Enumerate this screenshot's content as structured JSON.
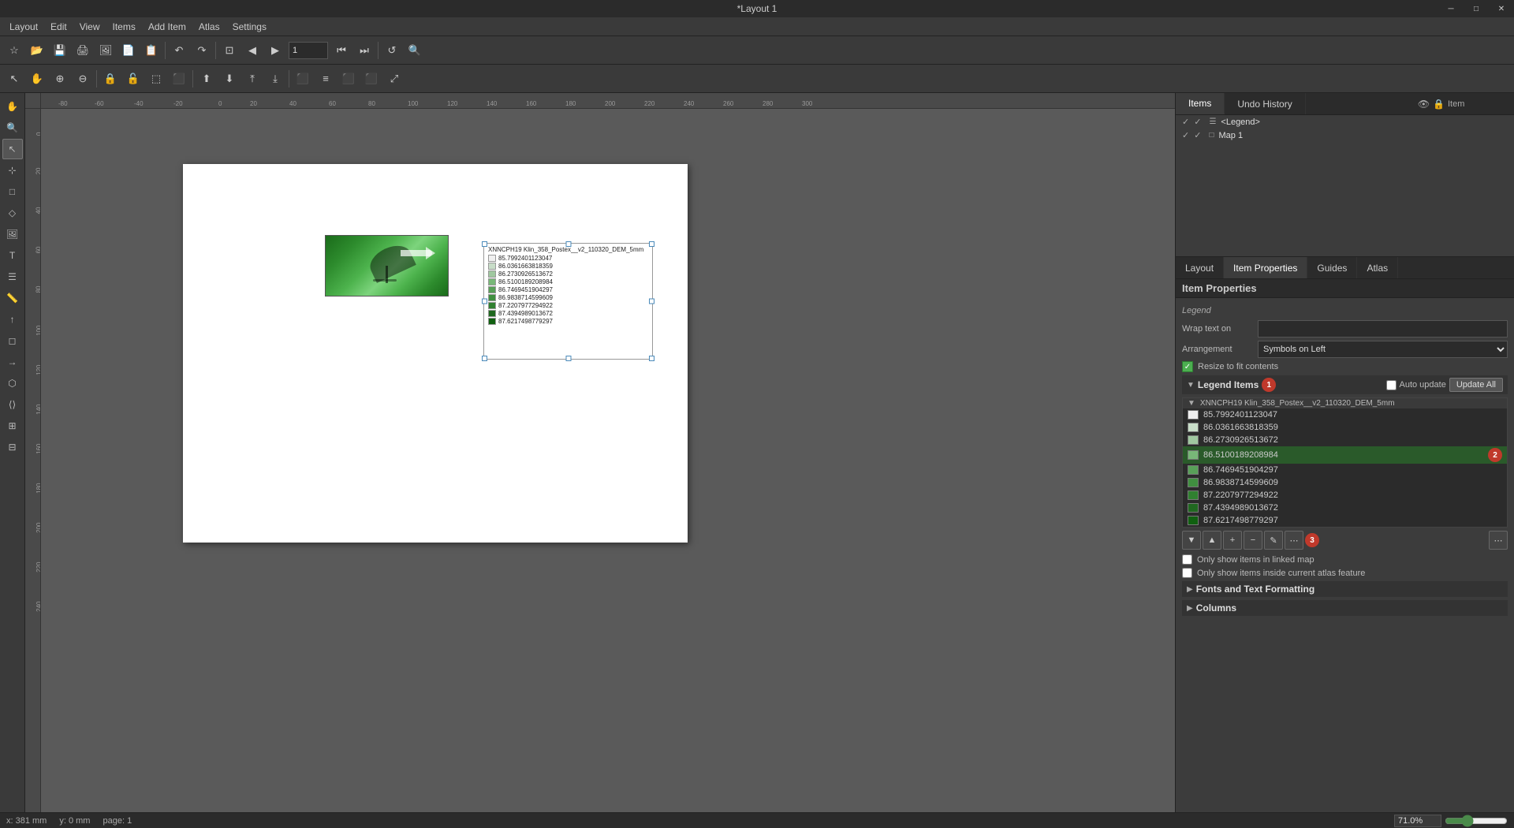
{
  "titleBar": {
    "title": "*Layout 1",
    "minimizeLabel": "─",
    "maximizeLabel": "□",
    "closeLabel": "✕"
  },
  "menuBar": {
    "items": [
      "Layout",
      "Edit",
      "View",
      "Items",
      "Add Item",
      "Atlas",
      "Settings"
    ]
  },
  "toolbar1": {
    "buttons": [
      {
        "name": "new",
        "icon": "☆"
      },
      {
        "name": "open",
        "icon": "📂"
      },
      {
        "name": "save",
        "icon": "💾"
      },
      {
        "name": "print",
        "icon": "🖨"
      },
      {
        "name": "export-pdf",
        "icon": "📄"
      },
      {
        "name": "undo",
        "icon": "↶"
      },
      {
        "name": "redo",
        "icon": "↷"
      },
      {
        "name": "atlas-settings",
        "icon": "⚙"
      },
      {
        "name": "atlas-prev",
        "icon": "◀"
      },
      {
        "name": "atlas-next",
        "icon": "▶"
      },
      {
        "name": "zoom-full",
        "icon": "⊡"
      },
      {
        "name": "zoom-100",
        "icon": "🔍"
      }
    ]
  },
  "leftTools": {
    "buttons": [
      {
        "name": "pan",
        "icon": "✋",
        "active": false
      },
      {
        "name": "zoom-pan",
        "icon": "⊕",
        "active": false
      },
      {
        "name": "select",
        "icon": "↖",
        "active": true
      },
      {
        "name": "move-item",
        "icon": "✛",
        "active": false
      },
      {
        "name": "add-map",
        "icon": "🗺",
        "active": false
      },
      {
        "name": "add-picture",
        "icon": "🖼",
        "active": false
      },
      {
        "name": "add-text",
        "icon": "T",
        "active": false
      },
      {
        "name": "add-legend",
        "icon": "☰",
        "active": false
      },
      {
        "name": "add-scalebar",
        "icon": "📏",
        "active": false
      },
      {
        "name": "add-shape",
        "icon": "◻",
        "active": false
      },
      {
        "name": "add-arrow",
        "icon": "→",
        "active": false
      },
      {
        "name": "add-node",
        "icon": "⬡",
        "active": false
      },
      {
        "name": "add-html",
        "icon": "⟨⟩",
        "active": false
      }
    ]
  },
  "panelTabs": {
    "items": [
      "Items",
      "Undo History"
    ]
  },
  "itemsPanel": {
    "header": {
      "col1": "Item"
    },
    "items": [
      {
        "visible": true,
        "locked": false,
        "type": "legend",
        "name": "<Legend>",
        "selected": false
      },
      {
        "visible": true,
        "locked": false,
        "type": "map",
        "name": "Map 1",
        "selected": false
      }
    ]
  },
  "bottomTabs": {
    "items": [
      "Layout",
      "Item Properties",
      "Guides",
      "Atlas"
    ],
    "active": "Item Properties"
  },
  "itemProperties": {
    "title": "Item Properties",
    "sectionLabel": "Legend",
    "wrapTextOnLabel": "Wrap text on",
    "arrangementLabel": "Arrangement",
    "arrangementValue": "Symbols on Left",
    "resizeLabel": "Resize to fit contents",
    "legendItemsSection": "Legend Items",
    "badge1": "1",
    "badge2": "2",
    "badge3": "3",
    "autoUpdateLabel": "Auto update",
    "updateAllLabel": "Update All",
    "legendItems": [
      {
        "level": "root",
        "name": "XNNCPH19 Klin_358_Postex__v2_110320_DEM_5mm",
        "color": null
      },
      {
        "level": "item",
        "name": "85.7992401123047",
        "color": "#f0f0f0"
      },
      {
        "level": "item",
        "name": "86.0361663818359",
        "color": "#c8e6c9"
      },
      {
        "level": "item",
        "name": "86.2730926513672",
        "color": "#a5d6a7"
      },
      {
        "level": "item",
        "name": "86.5100189208984",
        "color": "#81c784",
        "selected": true
      },
      {
        "level": "item",
        "name": "86.7469451904297",
        "color": "#66bb6a"
      },
      {
        "level": "item",
        "name": "86.9838714599609",
        "color": "#4caf50"
      },
      {
        "level": "item",
        "name": "87.2207977294922",
        "color": "#43a047"
      },
      {
        "level": "item",
        "name": "87.4394989013672",
        "color": "#388e3c"
      },
      {
        "level": "item",
        "name": "87.6217498779297",
        "color": "#2e7d32"
      }
    ],
    "listToolbar": [
      {
        "name": "move-down",
        "icon": "▼"
      },
      {
        "name": "move-up",
        "icon": "▲"
      },
      {
        "name": "add-group",
        "icon": "+"
      },
      {
        "name": "remove",
        "icon": "−"
      },
      {
        "name": "edit",
        "icon": "✎"
      },
      {
        "name": "more1",
        "icon": "⋯"
      },
      {
        "name": "more2",
        "icon": "⋯"
      }
    ],
    "checkboxes": [
      {
        "label": "Only show items in linked map",
        "checked": false
      },
      {
        "label": "Only show items inside current atlas feature",
        "checked": false
      }
    ],
    "collapsibleSections": [
      {
        "label": "Fonts and Text Formatting"
      },
      {
        "label": "Columns"
      }
    ]
  },
  "statusBar": {
    "x": "x: 381 mm",
    "y": "y: 0 mm",
    "page": "page: 1",
    "zoomValue": "71.0%"
  },
  "canvas": {
    "legendTitle": "XNNCPH19 Klin_358_Postex__v2_110320_DEM_5mm",
    "legendItems": [
      {
        "color": "#f0f0f0",
        "label": "85.7992401123047"
      },
      {
        "color": "#c8e6c9",
        "label": "86.0361663818359"
      },
      {
        "color": "#a5d6a7",
        "label": "86.2730926513672"
      },
      {
        "color": "#81c784",
        "label": "86.5100189208984"
      },
      {
        "color": "#66bb6a",
        "label": "86.7469451904297"
      },
      {
        "color": "#4caf50",
        "label": "86.9838714599609"
      },
      {
        "color": "#43a047",
        "label": "87.2207977294922"
      },
      {
        "color": "#388e3c",
        "label": "87.4394989013672"
      },
      {
        "color": "#2e7d32",
        "label": "87.6217498779297"
      }
    ]
  }
}
